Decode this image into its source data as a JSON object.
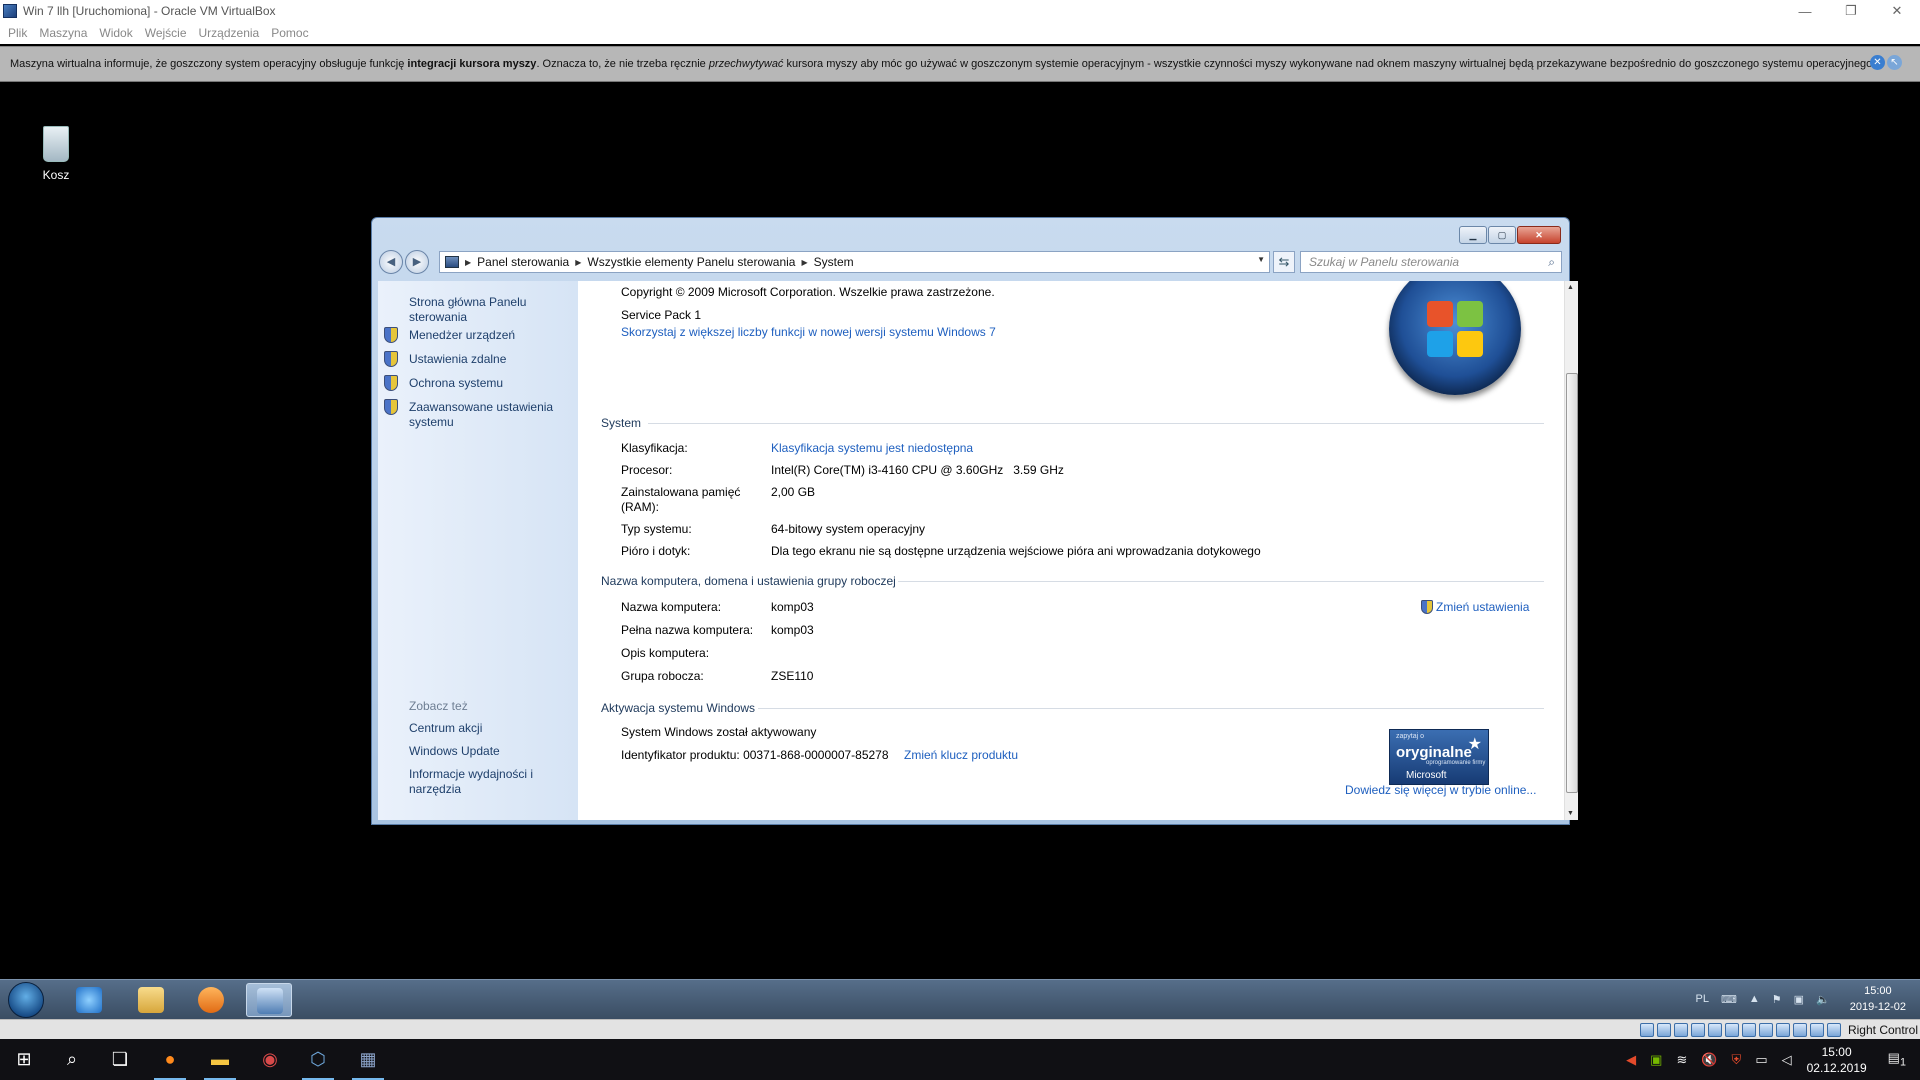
{
  "vbox": {
    "title": "Win 7 llh [Uruchomiona] - Oracle VM VirtualBox",
    "window_controls": {
      "minimize": "—",
      "restore": "❐",
      "close": "✕"
    },
    "menu": [
      "Plik",
      "Maszyna",
      "Widok",
      "Wejście",
      "Urządzenia",
      "Pomoc"
    ],
    "info": {
      "part1": "Maszyna wirtualna informuje, że goszczony system operacyjny obsługuje funkcję ",
      "bold": "integracji kursora myszy",
      "part2": ". Oznacza to, że nie trzeba ręcznie ",
      "italic": "przechwytywać",
      "part3": " kursora myszy aby móc go używać w goszczonym systemie operacyjnym - wszystkie czynności myszy wykonywane nad oknem maszyny wirtualnej będą przekazywane bezpośrednio do goszczonego systemu operacyjnego."
    },
    "status_right": "Right Control"
  },
  "desktop": {
    "recycle_bin_label": "Kosz"
  },
  "cp": {
    "breadcrumb": [
      "Panel sterowania",
      "Wszystkie elementy Panelu sterowania",
      "System"
    ],
    "search_placeholder": "Szukaj w Panelu sterowania",
    "left": {
      "home": "Strona główna Panelu sterowania",
      "links": [
        "Menedżer urządzeń",
        "Ustawienia zdalne",
        "Ochrona systemu",
        "Zaawansowane ustawienia systemu"
      ],
      "see_also": "Zobacz też",
      "see_links": [
        "Centrum akcji",
        "Windows Update",
        "Informacje wydajności i narzędzia"
      ]
    },
    "copyright": "Copyright © 2009 Microsoft Corporation. Wszelkie prawa zastrzeżone.",
    "service_pack": "Service Pack 1",
    "upgrade_link": "Skorzystaj z większej liczby funkcji w nowej wersji systemu Windows 7",
    "system": {
      "heading": "System",
      "rows": [
        {
          "label": "Klasyfikacja:",
          "value": "Klasyfikacja systemu jest niedostępna"
        },
        {
          "label": "Procesor:",
          "value": "Intel(R) Core(TM) i3-4160 CPU @ 3.60GHz   3.59 GHz"
        },
        {
          "label": "Zainstalowana pamięć (RAM):",
          "value": "2,00 GB"
        },
        {
          "label": "Typ systemu:",
          "value": "64-bitowy system operacyjny"
        },
        {
          "label": "Pióro i dotyk:",
          "value": "Dla tego ekranu nie są dostępne urządzenia wejściowe pióra ani wprowadzania dotykowego"
        }
      ]
    },
    "computer": {
      "heading": "Nazwa komputera, domena i ustawienia grupy roboczej",
      "change": "Zmień ustawienia",
      "rows": [
        {
          "label": "Nazwa komputera:",
          "value": "komp03"
        },
        {
          "label": "Pełna nazwa komputera:",
          "value": "komp03"
        },
        {
          "label": "Opis komputera:",
          "value": ""
        },
        {
          "label": "Grupa robocza:",
          "value": "ZSE110"
        }
      ]
    },
    "activation": {
      "heading": "Aktywacja systemu Windows",
      "status": "System Windows został aktywowany",
      "product_id": "Identyfikator produktu: 00371-868-0000007-85278",
      "change_key": "Zmień klucz produktu",
      "learn_more": "Dowiedz się więcej w trybie online...",
      "genuine": {
        "line1": "zapytaj o",
        "line2": "oryginalne",
        "line3": "oprogramowanie firmy",
        "line4": "Microsoft"
      }
    }
  },
  "guest_taskbar": {
    "lang": "PL",
    "time": "15:00",
    "date": "2019-12-02"
  },
  "host_taskbar": {
    "time": "15:00",
    "date": "02.12.2019",
    "notif_count": "1"
  },
  "colors": {
    "link": "#1e5fbf",
    "vb_info_bg": "#b7b7b7"
  }
}
